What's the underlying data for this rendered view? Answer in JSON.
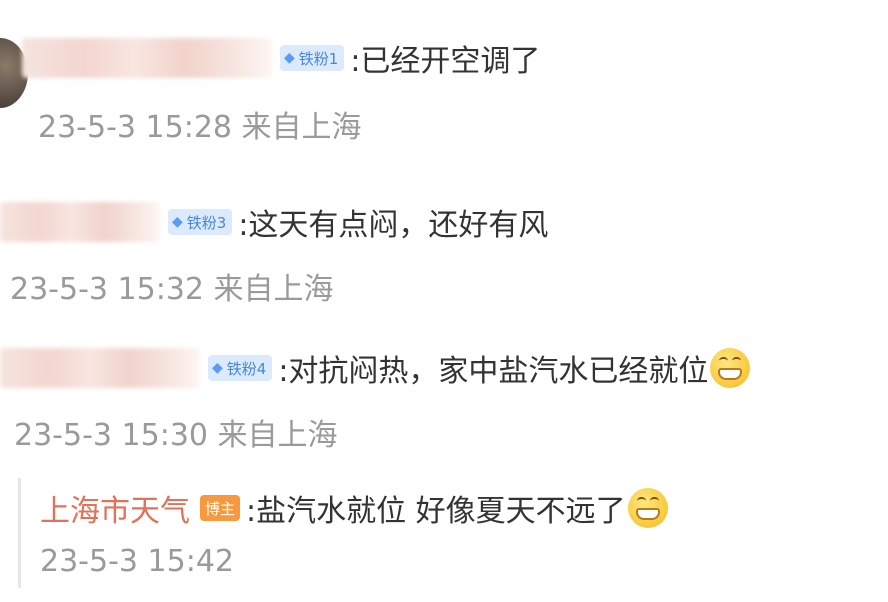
{
  "comments": [
    {
      "badge": "铁粉1",
      "text": ":已经开空调了",
      "time": "23-5-3 15:28",
      "location": "来自上海"
    },
    {
      "badge": "铁粉3",
      "text": ":这天有点闷，还好有风",
      "time": "23-5-3 15:32",
      "location": "来自上海"
    },
    {
      "badge": "铁粉4",
      "text": ":对抗闷热，家中盐汽水已经就位",
      "time": "23-5-3 15:30",
      "location": "来自上海",
      "emoji": "grin-emoji"
    }
  ],
  "reply": {
    "author": "上海市天气",
    "role_badge": "博主",
    "text": ":盐汽水就位 好像夏天不远了",
    "time": "23-5-3 15:42",
    "emoji": "grin-emoji"
  },
  "colors": {
    "author": "#e0715a",
    "badge_bg": "#dceaff",
    "badge_text": "#4a86d8",
    "owner_badge_bg": "#f79a3f",
    "meta_text": "#9a9a9a"
  }
}
